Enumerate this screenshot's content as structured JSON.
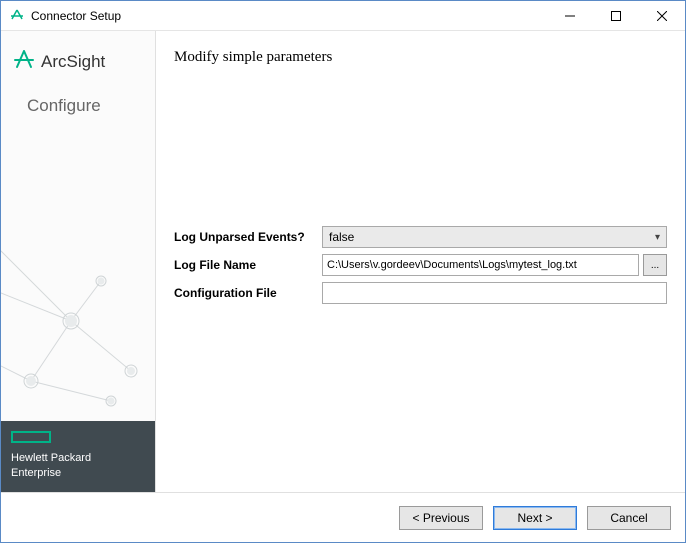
{
  "window": {
    "title": "Connector Setup"
  },
  "sidebar": {
    "brand": "ArcSight",
    "step": "Configure",
    "vendor_line1": "Hewlett Packard",
    "vendor_line2": "Enterprise"
  },
  "main": {
    "heading": "Modify simple parameters",
    "fields": {
      "log_unparsed_label": "Log Unparsed Events?",
      "log_unparsed_value": "false",
      "log_file_label": "Log File Name",
      "log_file_value": "C:\\Users\\v.gordeev\\Documents\\Logs\\mytest_log.txt",
      "browse_label": "...",
      "config_file_label": "Configuration File",
      "config_file_value": ""
    }
  },
  "footer": {
    "previous": "< Previous",
    "next": "Next >",
    "cancel": "Cancel"
  }
}
